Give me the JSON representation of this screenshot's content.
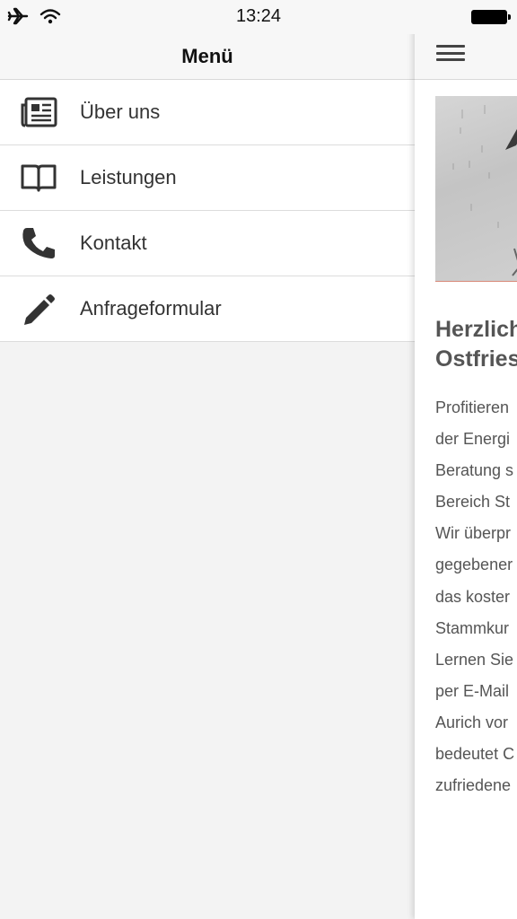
{
  "status_bar": {
    "time": "13:24",
    "icons": [
      "airplane-icon",
      "wifi-icon",
      "battery-icon"
    ]
  },
  "menu": {
    "title": "Menü",
    "items": [
      {
        "label": "Über uns",
        "icon": "newspaper-icon"
      },
      {
        "label": "Leistungen",
        "icon": "book-icon"
      },
      {
        "label": "Kontakt",
        "icon": "phone-icon"
      },
      {
        "label": "Anfrageformular",
        "icon": "pencil-icon"
      }
    ]
  },
  "content": {
    "heading_lines": [
      "Herzlich",
      "Ostfries"
    ],
    "paragraph_lines": [
      "Profitieren",
      "der Energi",
      "Beratung s",
      "Bereich St",
      "Wir überpr",
      "gegebener",
      "das koster",
      "Stammkur",
      "Lernen Sie",
      "per E-Mail",
      "Aurich vor",
      "bedeutet C",
      "zufriedene"
    ]
  },
  "colors": {
    "header_bg": "#f7f7f7",
    "menu_bg": "#f3f3f3",
    "icon_color": "#333333",
    "text_color": "#333333",
    "content_text": "#555555",
    "image_accent_line": "#d88a7a"
  }
}
